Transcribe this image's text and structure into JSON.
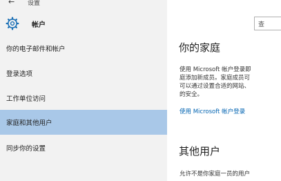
{
  "topbar": {
    "back_icon": "←",
    "title": "设置"
  },
  "header": {
    "title": "帐户"
  },
  "search": {
    "text": "查"
  },
  "sidebar": {
    "items": [
      {
        "label": "你的电子邮件和帐户"
      },
      {
        "label": "登录选项"
      },
      {
        "label": "工作单位访问"
      },
      {
        "label": "家庭和其他用户"
      },
      {
        "label": "同步你的设置"
      }
    ]
  },
  "family": {
    "heading": "你的家庭",
    "lines": [
      "使用 Microsoft 帐户登录即",
      "庭添加新成员。家庭成员可",
      "可以通过设置合适的网站、",
      "的安全。"
    ],
    "link": "使用 Microsoft 帐户登录"
  },
  "others": {
    "heading": "其他用户",
    "line": "允许不是你家庭一员的用户"
  },
  "colors": {
    "active": "#a9c8e8",
    "sidebar_bg": "#f2f2f2",
    "link": "#0063b1"
  }
}
